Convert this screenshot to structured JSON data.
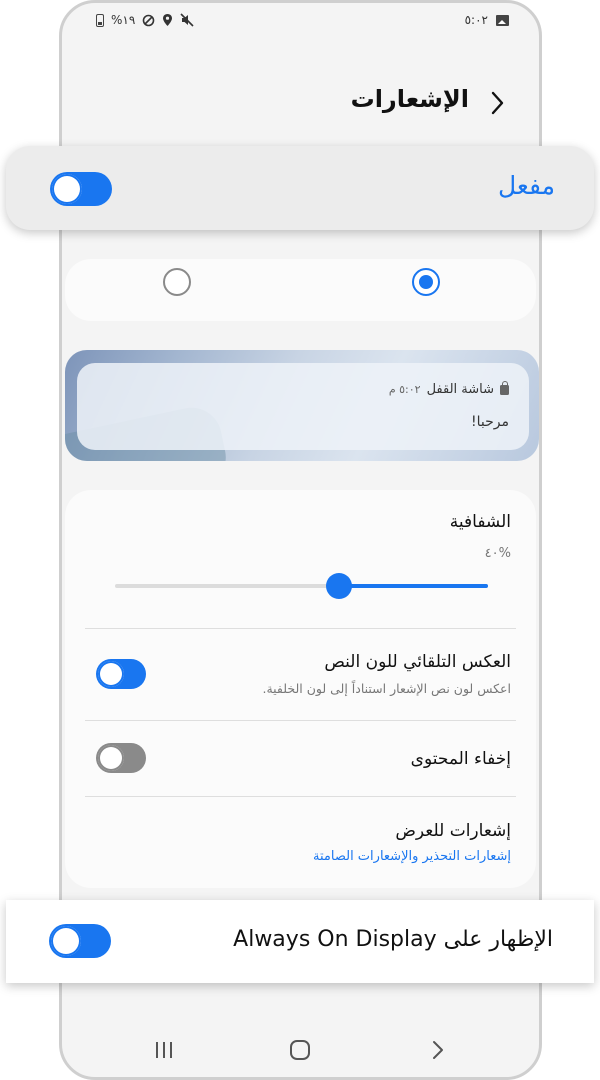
{
  "status_bar": {
    "battery_percent": "%١٩",
    "time": "٥:٠٢",
    "icons": [
      "battery-icon",
      "dnd-icon",
      "location-icon",
      "mute-icon",
      "gallery-icon"
    ]
  },
  "header": {
    "title": "الإشعارات"
  },
  "master_toggle": {
    "label": "مفعل",
    "on": true
  },
  "style_options": {
    "selected_index": 0,
    "count": 2
  },
  "preview": {
    "app_name": "شاشة القفل",
    "time": "٥:٠٢ م",
    "message": "مرحبا!"
  },
  "transparency": {
    "label": "الشفافية",
    "value_text": "%٤٠",
    "value": 0.4
  },
  "invert_text": {
    "title": "العكس التلقائي للون النص",
    "subtitle": "اعكس لون نص الإشعار استناداً إلى لون الخلفية.",
    "on": true
  },
  "hide_content": {
    "title": "إخفاء المحتوى",
    "on": false
  },
  "notifications_to_show": {
    "title": "إشعارات للعرض",
    "value": "إشعارات التحذير والإشعارات الصامتة"
  },
  "aod_toggle": {
    "label": "الإظهار على Always On Display",
    "on": true
  },
  "colors": {
    "accent": "#1976f0",
    "off_track": "#8a8a8a",
    "background": "#f4f4f4",
    "card": "#fbfbfb"
  }
}
